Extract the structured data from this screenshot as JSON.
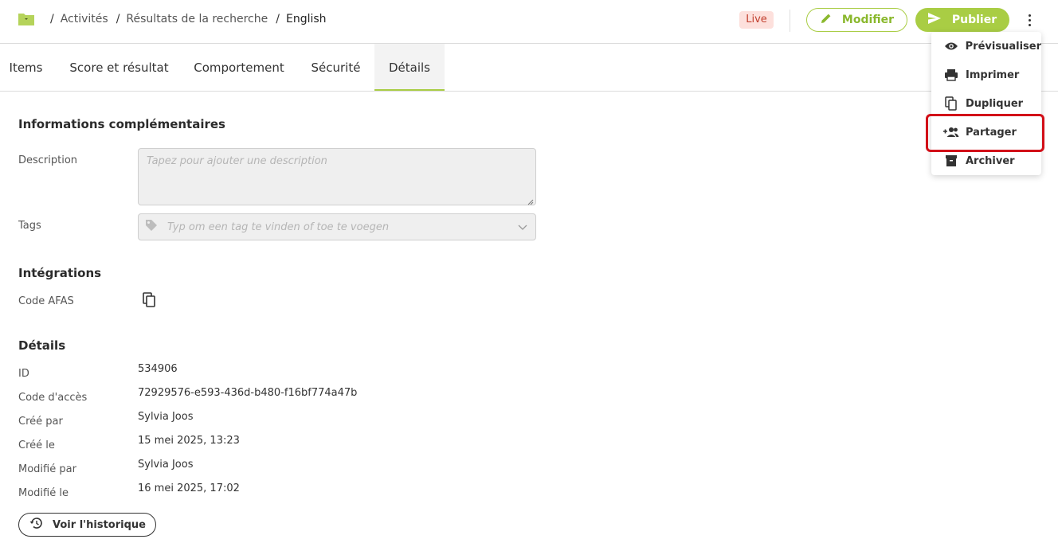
{
  "header": {
    "breadcrumb": [
      "Activités",
      "Résultats de la recherche",
      "English"
    ],
    "status_badge": "Live",
    "modify_label": "Modifier",
    "publish_label": "Publier"
  },
  "tabs": [
    {
      "label": "Items"
    },
    {
      "label": "Score et résultat"
    },
    {
      "label": "Comportement"
    },
    {
      "label": "Sécurité"
    },
    {
      "label": "Détails",
      "active": true
    }
  ],
  "info": {
    "title": "Informations complémentaires",
    "description_label": "Description",
    "description_placeholder": "Tapez pour ajouter une description",
    "tags_label": "Tags",
    "tags_placeholder": "Typ om een tag te vinden of toe te voegen"
  },
  "integrations": {
    "title": "Intégrations",
    "afas_label": "Code AFAS"
  },
  "details": {
    "title": "Détails",
    "rows": [
      {
        "label": "ID",
        "value": "534906"
      },
      {
        "label": "Code d'accès",
        "value": "72929576-e593-436d-b480-f16bf774a47b"
      },
      {
        "label": "Créé par",
        "value": "Sylvia Joos"
      },
      {
        "label": "Créé le",
        "value": "15 mei 2025, 13:23"
      },
      {
        "label": "Modifié par",
        "value": "Sylvia Joos"
      },
      {
        "label": "Modifié le",
        "value": "16 mei 2025, 17:02"
      }
    ],
    "history_button": "Voir l'historique"
  },
  "menu": {
    "items": [
      {
        "label": "Prévisualiser",
        "icon": "eye-icon"
      },
      {
        "label": "Imprimer",
        "icon": "printer-icon"
      },
      {
        "label": "Dupliquer",
        "icon": "copy-icon"
      },
      {
        "label": "Partager",
        "icon": "share-user-icon",
        "highlighted": true
      },
      {
        "label": "Archiver",
        "icon": "archive-icon"
      }
    ]
  },
  "colors": {
    "accent": "#a9cd44",
    "live_bg": "#fde0dc",
    "live_text": "#c2402f",
    "highlight": "#d20f18"
  }
}
